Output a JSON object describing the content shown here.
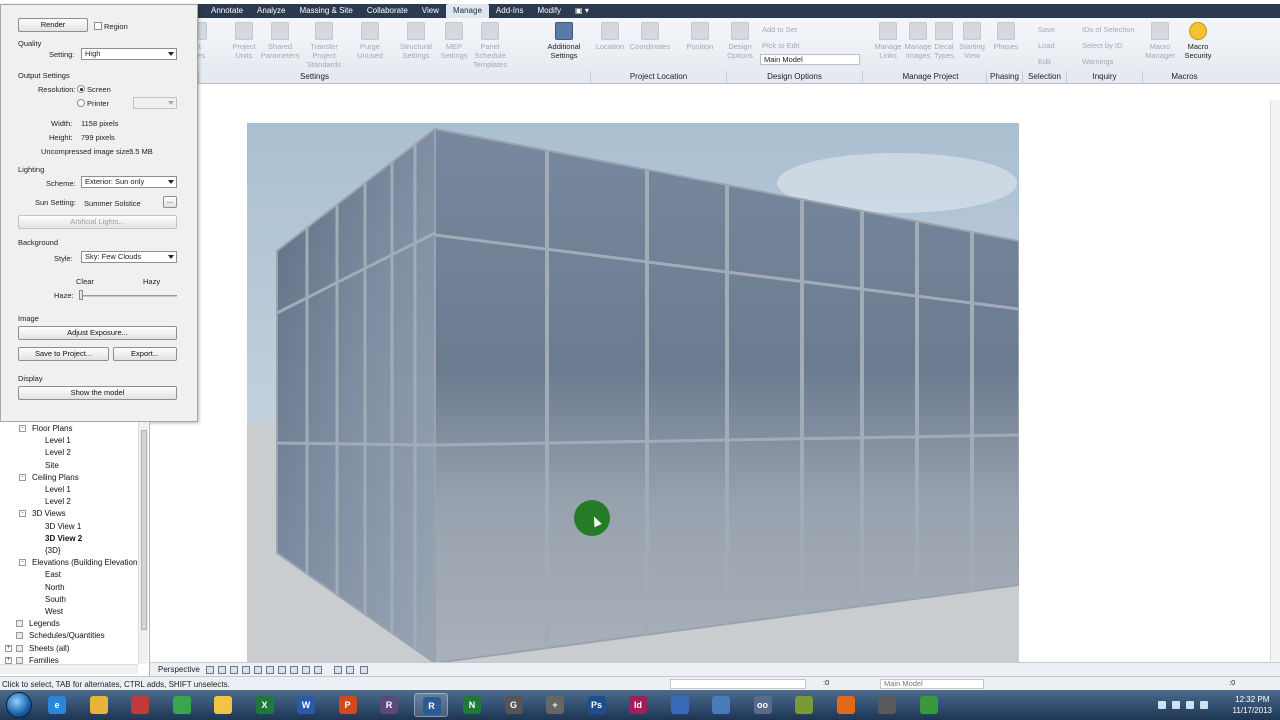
{
  "ribbon": {
    "tabs": [
      "Annotate",
      "Analyze",
      "Massing & Site",
      "Collaborate",
      "View",
      "Manage",
      "Add-Ins",
      "Modify"
    ],
    "active_tab": "Manage",
    "buttons": [
      {
        "label": "ct\netes",
        "x": 0
      },
      {
        "label": "Project\nUnits"
      },
      {
        "label": "Shared\nParameters"
      },
      {
        "label": "Transfer\nProject Standards"
      },
      {
        "label": "Purge\nUnused"
      },
      {
        "label": "Structural\nSettings"
      },
      {
        "label": "MEP\nSettings"
      },
      {
        "label": "Panel Schedule\nTemplates"
      },
      {
        "label": "Additional\nSettings"
      },
      {
        "label": "Location"
      },
      {
        "label": "Coordinates"
      },
      {
        "label": "Position"
      },
      {
        "label": "Design\nOptions"
      },
      {
        "label": "Manage\nLinks"
      },
      {
        "label": "Manage\nImages"
      },
      {
        "label": "Decal\nTypes"
      },
      {
        "label": "Starting\nView"
      },
      {
        "label": "Phases"
      },
      {
        "label": "Macro\nManager"
      },
      {
        "label": "Macro\nSecurity"
      }
    ],
    "small_cmds": {
      "design_options": [
        "Add to Set",
        "Pick to Edit"
      ],
      "selection": [
        "Save",
        "Load",
        "Edit"
      ],
      "inquiry": [
        "IDs of Selection",
        "Select by ID",
        "Warnings"
      ]
    },
    "design_option_dropdown": "Main Model",
    "groups": [
      "Settings",
      "Project Location",
      "Design Options",
      "Manage Project",
      "Phasing",
      "Selection",
      "Inquiry",
      "Macros"
    ]
  },
  "render_dialog": {
    "render_button": "Render",
    "region_label": "Region",
    "quality_section": "Quality",
    "setting_label": "Setting:",
    "setting_value": "High",
    "output_section": "Output Settings",
    "resolution_label": "Resolution:",
    "screen_label": "Screen",
    "printer_label": "Printer",
    "width_label": "Width:",
    "width_value": "1158 pixels",
    "height_label": "Height:",
    "height_value": "799 pixels",
    "uncompressed_label": "Uncompressed image size:",
    "uncompressed_value": "3.5 MB",
    "lighting_section": "Lighting",
    "scheme_label": "Scheme:",
    "scheme_value": "Exterior: Sun only",
    "sun_label": "Sun Setting:",
    "sun_value": "Summer Solstice",
    "sun_button": "...",
    "artificial_button": "Artificial Lights...",
    "background_section": "Background",
    "style_label": "Style:",
    "style_value": "Sky: Few Clouds",
    "clear_label": "Clear",
    "hazy_label": "Hazy",
    "haze_label": "Haze:",
    "image_section": "Image",
    "adjust_button": "Adjust Exposure...",
    "save_button": "Save to Project...",
    "export_button": "Export...",
    "display_section": "Display",
    "show_button": "Show the model"
  },
  "project_browser": {
    "items": [
      {
        "label": "Floor Plans",
        "level": 1,
        "toggle": "-"
      },
      {
        "label": "Level 1",
        "level": 2
      },
      {
        "label": "Level 2",
        "level": 2
      },
      {
        "label": "Site",
        "level": 2
      },
      {
        "label": "Ceiling Plans",
        "level": 1,
        "toggle": "-"
      },
      {
        "label": "Level 1",
        "level": 2
      },
      {
        "label": "Level 2",
        "level": 2
      },
      {
        "label": "3D Views",
        "level": 1,
        "toggle": "-"
      },
      {
        "label": "3D View 1",
        "level": 2
      },
      {
        "label": "3D View 2",
        "level": 2,
        "selected": true
      },
      {
        "label": "{3D}",
        "level": 2
      },
      {
        "label": "Elevations (Building Elevation",
        "level": 1,
        "toggle": "-"
      },
      {
        "label": "East",
        "level": 2
      },
      {
        "label": "North",
        "level": 2
      },
      {
        "label": "South",
        "level": 2
      },
      {
        "label": "West",
        "level": 2
      },
      {
        "label": "Legends",
        "level": 0
      },
      {
        "label": "Schedules/Quantities",
        "level": 0
      },
      {
        "label": "Sheets (all)",
        "level": 0,
        "toggle": "+"
      },
      {
        "label": "Families",
        "level": 0,
        "toggle": "+"
      }
    ]
  },
  "view_bar": {
    "mode": "Perspective"
  },
  "status": {
    "text": "Click to select, TAB for alternates, CTRL adds, SHIFT unselects.",
    "coord": ":0",
    "model": "Main Model",
    "filter": ":0"
  },
  "taskbar": {
    "time": "12:32 PM",
    "date": "11/17/2013",
    "apps": [
      {
        "name": "ie-icon",
        "glyph": "e",
        "color": "#2a86d8"
      },
      {
        "name": "explorer-icon",
        "glyph": "",
        "color": "#e8b53a"
      },
      {
        "name": "tool-icon",
        "glyph": "",
        "color": "#c23b3b"
      },
      {
        "name": "chrome-icon",
        "glyph": "",
        "color": "#3aa54b"
      },
      {
        "name": "folder-icon",
        "glyph": "",
        "color": "#f2c446"
      },
      {
        "name": "excel-icon",
        "glyph": "X",
        "color": "#1f7a3a"
      },
      {
        "name": "word-icon",
        "glyph": "W",
        "color": "#2a5aa8"
      },
      {
        "name": "powerpoint-icon",
        "glyph": "P",
        "color": "#d14a1f"
      },
      {
        "name": "revit-r-icon",
        "glyph": "R",
        "color": "#5a4a7a"
      },
      {
        "name": "revit-icon",
        "glyph": "R",
        "color": "#2a5b96"
      },
      {
        "name": "project-icon",
        "glyph": "N",
        "color": "#1f7a3a"
      },
      {
        "name": "app-g-icon",
        "glyph": "G",
        "color": "#555"
      },
      {
        "name": "snip-icon",
        "glyph": "+",
        "color": "#666"
      },
      {
        "name": "photoshop-icon",
        "glyph": "Ps",
        "color": "#1f4f8a"
      },
      {
        "name": "indesign-icon",
        "glyph": "Id",
        "color": "#a01e5a"
      },
      {
        "name": "outlook-icon",
        "glyph": "",
        "color": "#3a6ab8"
      },
      {
        "name": "cloud-icon",
        "glyph": "",
        "color": "#4a7ab8"
      },
      {
        "name": "app-oo-icon",
        "glyph": "oo",
        "color": "#5a6a8a"
      },
      {
        "name": "notepad-icon",
        "glyph": "",
        "color": "#7a9a3a"
      },
      {
        "name": "firefox-icon",
        "glyph": "",
        "color": "#e06a1a"
      },
      {
        "name": "media-icon",
        "glyph": "",
        "color": "#5a5a5a"
      },
      {
        "name": "project2-icon",
        "glyph": "",
        "color": "#3a9a3a"
      }
    ]
  }
}
